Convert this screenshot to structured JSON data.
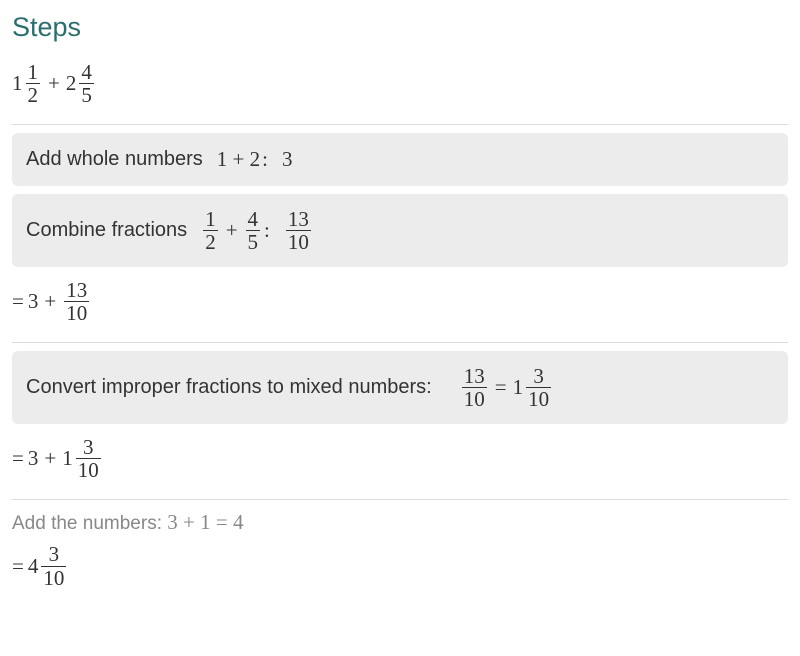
{
  "title": "Steps",
  "problem": {
    "term1": {
      "whole": "1",
      "num": "1",
      "den": "2"
    },
    "op": "+",
    "term2": {
      "whole": "2",
      "num": "4",
      "den": "5"
    }
  },
  "step1": {
    "label": "Add whole numbers",
    "expr": "1 + 2",
    "result": "3"
  },
  "step2": {
    "label": "Combine fractions",
    "f1": {
      "num": "1",
      "den": "2"
    },
    "op": "+",
    "f2": {
      "num": "4",
      "den": "5"
    },
    "result": {
      "num": "13",
      "den": "10"
    }
  },
  "line1": {
    "eq": "=",
    "whole": "3",
    "op": "+",
    "frac": {
      "num": "13",
      "den": "10"
    }
  },
  "step3": {
    "label": "Convert improper fractions to mixed numbers:",
    "lhs": {
      "num": "13",
      "den": "10"
    },
    "eq": "=",
    "rhs": {
      "whole": "1",
      "num": "3",
      "den": "10"
    }
  },
  "line2": {
    "eq": "=",
    "a": "3",
    "op": "+",
    "b": {
      "whole": "1",
      "num": "3",
      "den": "10"
    }
  },
  "note": {
    "label": "Add the numbers:",
    "expr": "3 + 1 = 4"
  },
  "line3": {
    "eq": "=",
    "result": {
      "whole": "4",
      "num": "3",
      "den": "10"
    }
  }
}
